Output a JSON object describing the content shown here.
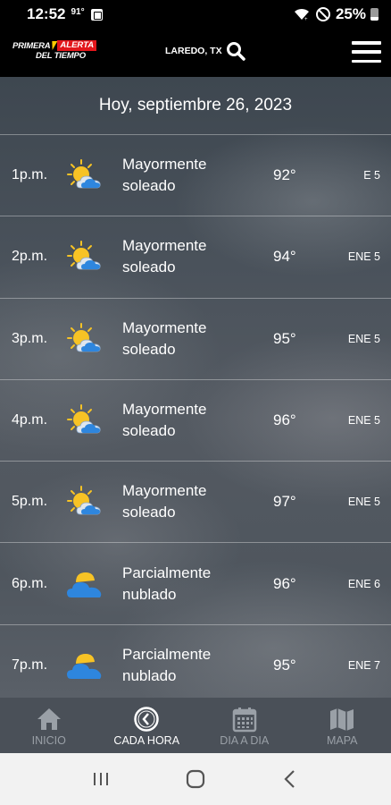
{
  "status_bar": {
    "time": "12:52",
    "temp": "91°",
    "battery_text": "25%"
  },
  "header": {
    "logo_primera": "PRIMERA",
    "logo_alerta": "ALERTA",
    "logo_del_tiempo": "DEL TIEMPO",
    "location": "LAREDO, TX",
    "search_icon": "search-icon",
    "menu_icon": "hamburger-menu-icon"
  },
  "date_title": "Hoy, septiembre 26, 2023",
  "hours": [
    {
      "time": "1p.m.",
      "icon": "sun-cloud-icon",
      "condition_line1": "Mayormente",
      "condition_line2": "soleado",
      "temp": "92°",
      "wind": "E 5"
    },
    {
      "time": "2p.m.",
      "icon": "sun-cloud-icon",
      "condition_line1": "Mayormente",
      "condition_line2": "soleado",
      "temp": "94°",
      "wind": "ENE 5"
    },
    {
      "time": "3p.m.",
      "icon": "sun-cloud-icon",
      "condition_line1": "Mayormente",
      "condition_line2": "soleado",
      "temp": "95°",
      "wind": "ENE 5"
    },
    {
      "time": "4p.m.",
      "icon": "sun-cloud-icon",
      "condition_line1": "Mayormente",
      "condition_line2": "soleado",
      "temp": "96°",
      "wind": "ENE 5"
    },
    {
      "time": "5p.m.",
      "icon": "sun-cloud-icon",
      "condition_line1": "Mayormente",
      "condition_line2": "soleado",
      "temp": "97°",
      "wind": "ENE 5"
    },
    {
      "time": "6p.m.",
      "icon": "partly-cloudy-icon",
      "condition_line1": "Parcialmente",
      "condition_line2": "nublado",
      "temp": "96°",
      "wind": "ENE 6"
    },
    {
      "time": "7p.m.",
      "icon": "partly-cloudy-icon",
      "condition_line1": "Parcialmente",
      "condition_line2": "nublado",
      "temp": "95°",
      "wind": "ENE 7"
    }
  ],
  "tabs": [
    {
      "label": "INICIO",
      "icon": "home-icon",
      "active": false
    },
    {
      "label": "CADA HORA",
      "icon": "clock-icon",
      "active": true
    },
    {
      "label": "DIA A DIA",
      "icon": "calendar-icon",
      "active": false
    },
    {
      "label": "MAPA",
      "icon": "map-icon",
      "active": false
    }
  ],
  "colors": {
    "alerta_red": "#e3161b",
    "bolt_yellow": "#ffcc00",
    "tab_bar": "#4a5058",
    "tab_inactive": "#9aa0a7",
    "cloud_blue": "#2e86de",
    "sun_yellow": "#f7c325"
  }
}
